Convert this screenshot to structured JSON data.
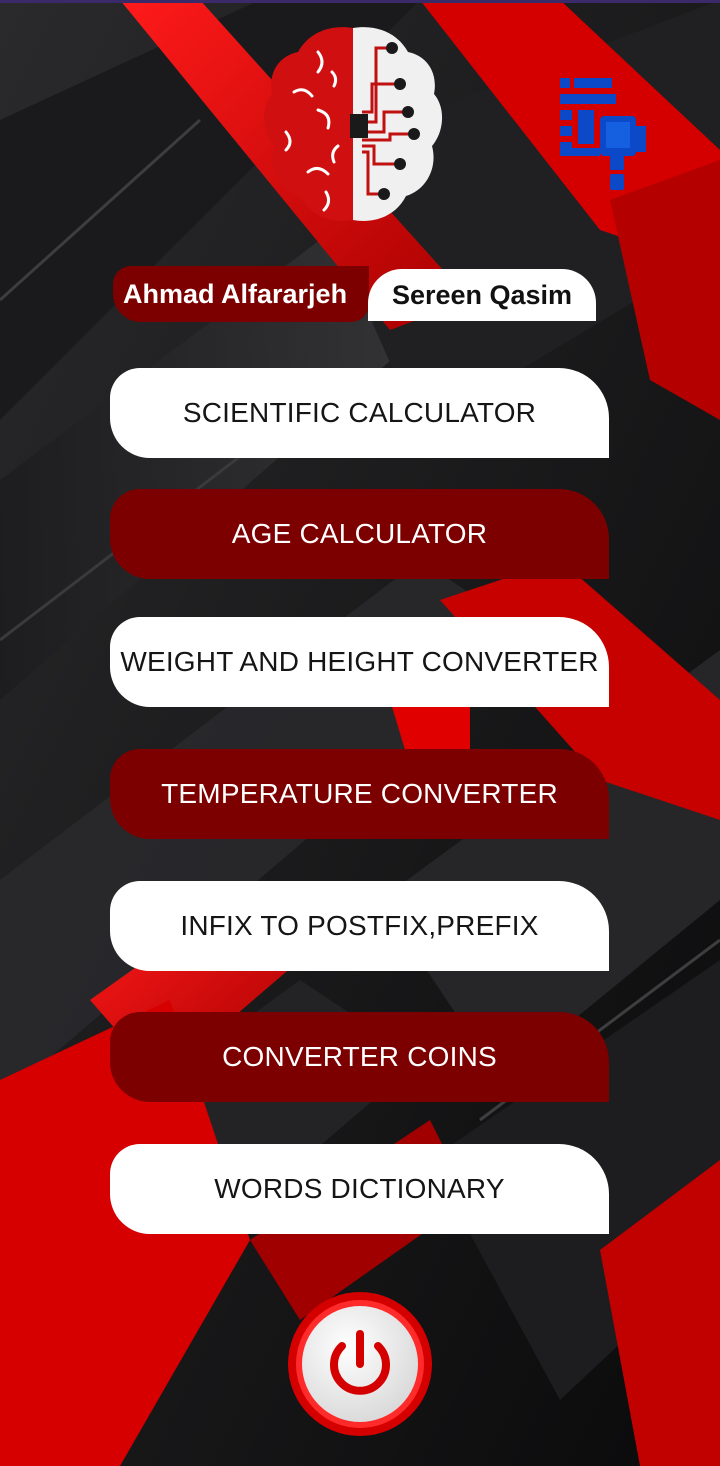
{
  "authors": {
    "left": "Ahmad Alfararjeh",
    "right": "Sereen Qasim"
  },
  "menu": [
    {
      "label": "SCIENTIFIC CALCULATOR",
      "style": "light"
    },
    {
      "label": "AGE CALCULATOR",
      "style": "dark"
    },
    {
      "label": "WEIGHT AND HEIGHT CONVERTER",
      "style": "light"
    },
    {
      "label": "TEMPERATURE CONVERTER",
      "style": "dark"
    },
    {
      "label": "INFIX TO POSTFIX,PREFIX",
      "style": "light"
    },
    {
      "label": "CONVERTER COINS",
      "style": "dark"
    },
    {
      "label": "WORDS DICTIONARY",
      "style": "light"
    }
  ],
  "icons": {
    "logo": "brain-circuit-icon",
    "document": "document-edit-icon",
    "power": "power-icon"
  },
  "colors": {
    "accent_dark_red": "#7d0000",
    "accent_red": "#d90000",
    "icon_blue": "#0b49c8",
    "background": "#0b0b0c"
  }
}
